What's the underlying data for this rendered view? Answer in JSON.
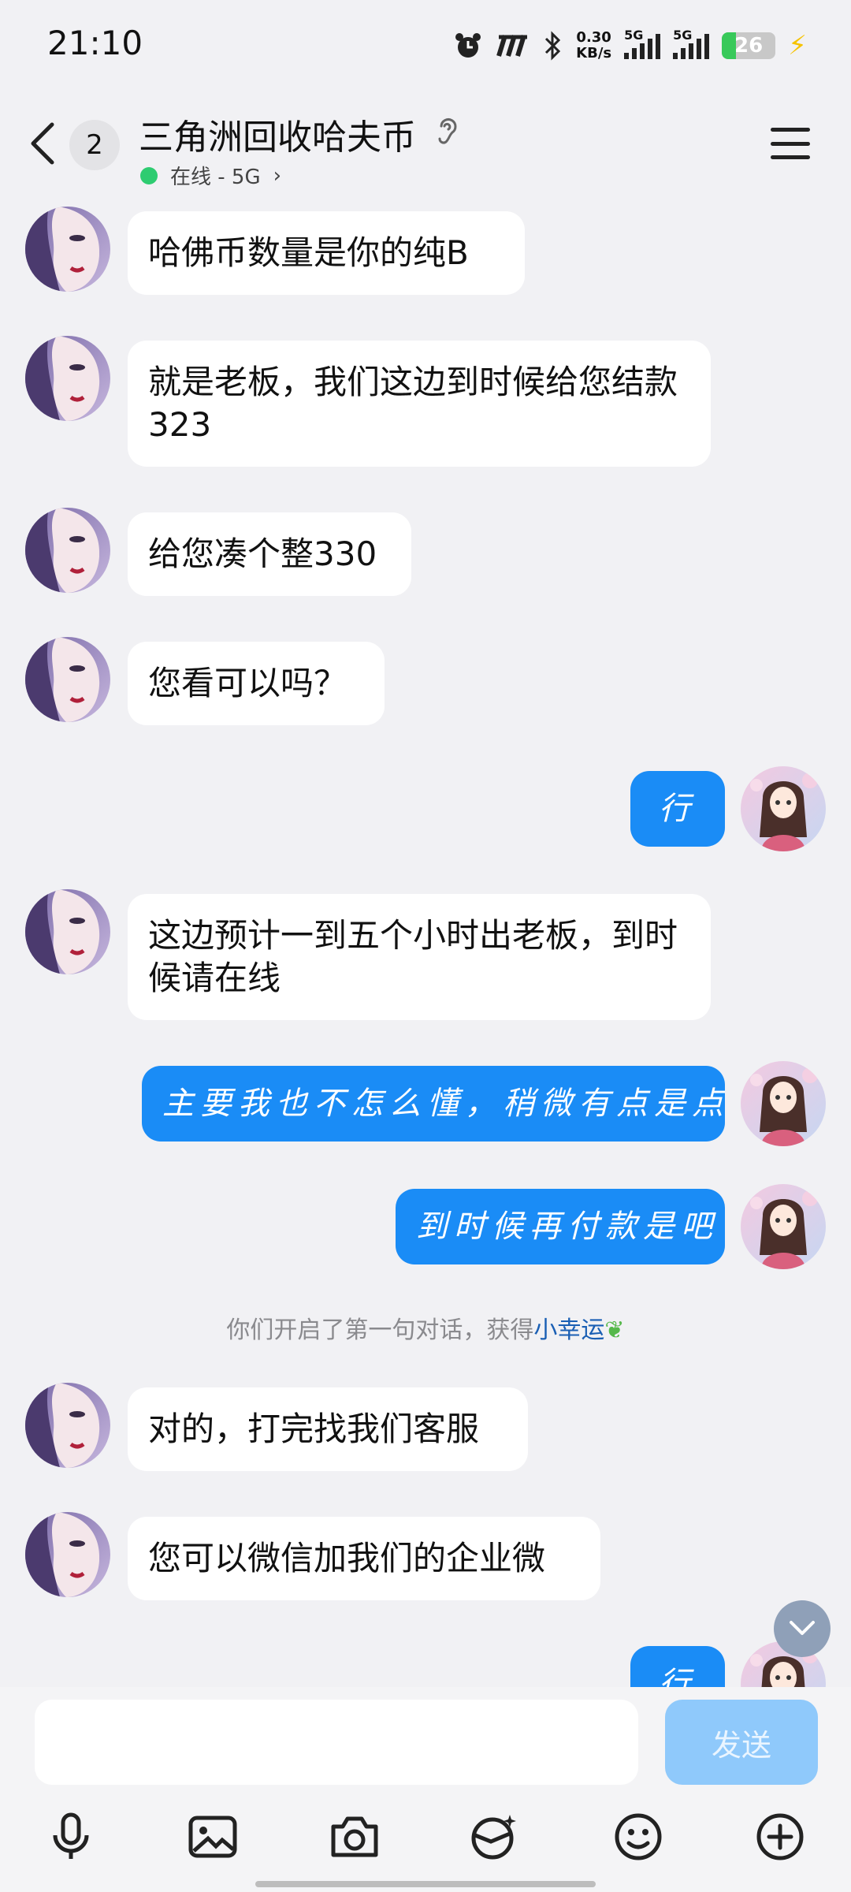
{
  "status_bar": {
    "time": "21:10",
    "net_speed_value": "0.30",
    "net_speed_unit": "KB/s",
    "sim1_label": "5G",
    "sim2_label": "5G",
    "battery_level": "26",
    "battery_fraction": 0.26
  },
  "header": {
    "unread_count": "2",
    "title": "三角洲回收哈夫币",
    "online_status": "在线 - 5G"
  },
  "messages": [
    {
      "side": "in",
      "text": "哈佛币数量是你的纯B"
    },
    {
      "side": "in",
      "text": "就是老板，我们这边到时候给您结款323"
    },
    {
      "side": "in",
      "text": "给您凑个整330"
    },
    {
      "side": "in",
      "text": "您看可以吗？"
    },
    {
      "side": "out",
      "text": "行"
    },
    {
      "side": "in",
      "text": "这边预计一到五个小时出老板，到时候请在线"
    },
    {
      "side": "out",
      "text": "主要我也不怎么懂，稍微有点是点"
    },
    {
      "side": "out",
      "text": "到时候再付款是吧"
    },
    {
      "side": "in",
      "text": "对的，打完找我们客服"
    },
    {
      "side": "in",
      "text": "您可以微信加我们的企业微"
    },
    {
      "side": "out",
      "text": "行"
    }
  ],
  "system_note": {
    "prefix": "你们开启了第一句对话，获得",
    "highlight": "小幸运"
  },
  "composer": {
    "input_value": "",
    "send_label": "发送"
  },
  "toolbar_icons": [
    "microphone-icon",
    "image-icon",
    "camera-icon",
    "emoji-mask-icon",
    "smile-icon",
    "plus-icon"
  ],
  "colors": {
    "background": "#f1f1f4",
    "outgoing_bubble": "#1a8cf6",
    "incoming_bubble": "#ffffff",
    "online_dot": "#2ecc71",
    "send_button": "#8fc9fb"
  }
}
